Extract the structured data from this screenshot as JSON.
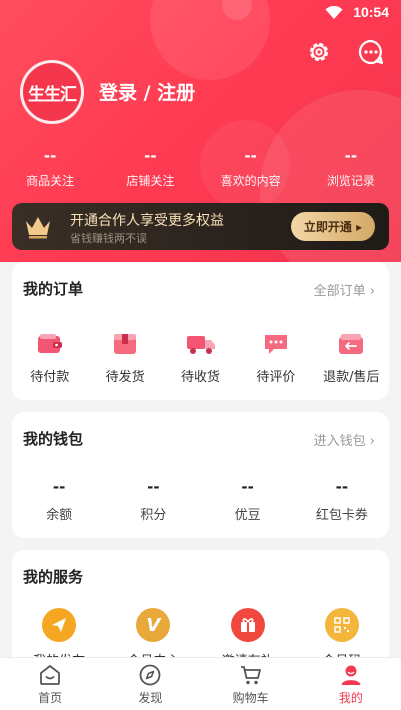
{
  "status_bar": {
    "time": "10:54"
  },
  "profile": {
    "avatar_text": "生生汇",
    "login_label": "登录 / 注册"
  },
  "stats": [
    {
      "value": "--",
      "label": "商品关注"
    },
    {
      "value": "--",
      "label": "店铺关注"
    },
    {
      "value": "--",
      "label": "喜欢的内容"
    },
    {
      "value": "--",
      "label": "浏览记录"
    }
  ],
  "banner": {
    "title": "开通合作人享受更多权益",
    "subtitle": "省钱赚钱两不误",
    "button": "立即开通 ▸"
  },
  "orders": {
    "title": "我的订单",
    "link": "全部订单 ›",
    "items": [
      {
        "label": "待付款",
        "icon": "wallet-icon"
      },
      {
        "label": "待发货",
        "icon": "box-icon"
      },
      {
        "label": "待收货",
        "icon": "truck-icon"
      },
      {
        "label": "待评价",
        "icon": "comment-icon"
      },
      {
        "label": "退款/售后",
        "icon": "refund-icon"
      }
    ]
  },
  "wallet": {
    "title": "我的钱包",
    "link": "进入钱包 ›",
    "items": [
      {
        "value": "--",
        "label": "余额"
      },
      {
        "value": "--",
        "label": "积分"
      },
      {
        "value": "--",
        "label": "优豆"
      },
      {
        "value": "--",
        "label": "红包卡券"
      }
    ]
  },
  "services": {
    "title": "我的服务",
    "items": [
      {
        "label": "我的发布",
        "icon": "send-icon",
        "color": "#f5a623"
      },
      {
        "label": "会员中心",
        "icon": "vip-icon",
        "color": "#e8a93a"
      },
      {
        "label": "邀请有礼",
        "icon": "gift-icon",
        "color": "#f0483e"
      },
      {
        "label": "会员码",
        "icon": "qrcode-icon",
        "color": "#f3b53a"
      }
    ]
  },
  "tabbar": [
    {
      "label": "首页",
      "icon": "home-icon"
    },
    {
      "label": "发现",
      "icon": "compass-icon"
    },
    {
      "label": "购物车",
      "icon": "cart-icon"
    },
    {
      "label": "我的",
      "icon": "user-icon",
      "active": true
    }
  ],
  "colors": {
    "brand": "#f23a50",
    "gold": "#f6e0b5"
  }
}
